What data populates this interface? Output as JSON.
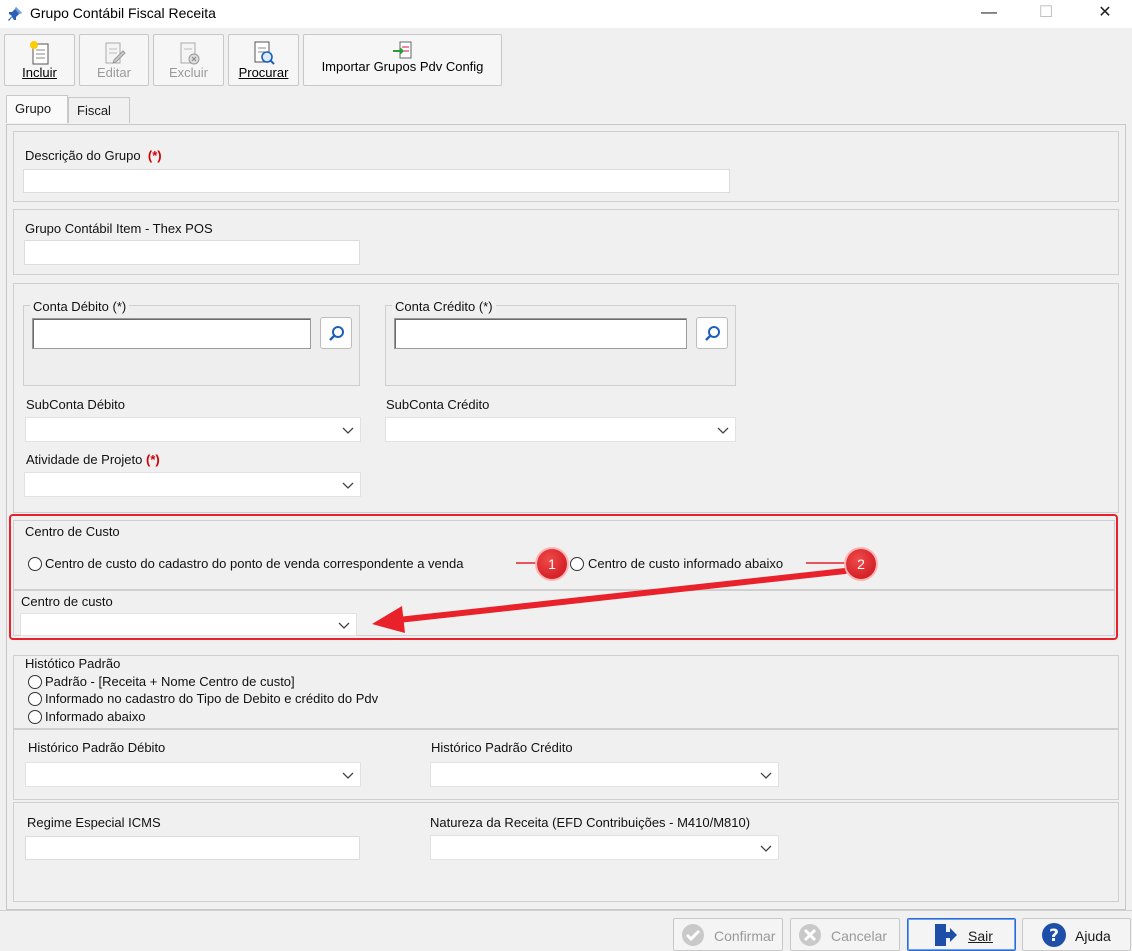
{
  "window": {
    "title": "Grupo Contábil Fiscal Receita",
    "minimize": "—",
    "maximize": "☐",
    "close": "✕"
  },
  "toolbar": {
    "incluir": "Incluir",
    "editar": "Editar",
    "excluir": "Excluir",
    "procurar": "Procurar",
    "importar": "Importar Grupos Pdv Config"
  },
  "tabs": {
    "grupo": "Grupo",
    "fiscal": "Fiscal"
  },
  "form": {
    "descricao_label": "Descrição do Grupo",
    "required_mark": "(*)",
    "descricao_value": "",
    "item_thex_label": "Grupo Contábil Item - Thex POS",
    "item_thex_value": "",
    "conta_debito_label": "Conta Débito (*)",
    "conta_debito_value": "",
    "conta_credito_label": "Conta Crédito (*)",
    "conta_credito_value": "",
    "subconta_debito_label": "SubConta Débito",
    "subconta_debito_value": "",
    "subconta_credito_label": "SubConta Crédito",
    "subconta_credito_value": "",
    "atividade_label": "Atividade de Projeto",
    "atividade_value": "",
    "centro_custo_group_label": "Centro de Custo",
    "centro_custo_option1": "Centro de custo do cadastro do ponto de venda correspondente a venda",
    "centro_custo_option2": "Centro de custo informado abaixo",
    "centro_custo_field_label": "Centro de custo",
    "centro_custo_value": "",
    "historico_label": "Histótico Padrão",
    "historico_option1": "Padrão - [Receita + Nome Centro de custo]",
    "historico_option2": "Informado no cadastro do Tipo de Debito e crédito do Pdv",
    "historico_option3": "Informado abaixo",
    "historico_debito_label": "Histórico Padrão Débito",
    "historico_debito_value": "",
    "historico_credito_label": "Histórico Padrão Crédito",
    "historico_credito_value": "",
    "regime_label": "Regime Especial ICMS",
    "regime_value": "",
    "natureza_label": "Natureza da Receita (EFD Contribuições - M410/M810)",
    "natureza_value": ""
  },
  "annotations": {
    "badge1": "1",
    "badge2": "2",
    "color": "#e8212a"
  },
  "footer": {
    "confirmar": "Confirmar",
    "cancelar": "Cancelar",
    "sair": "Sair",
    "ajuda": "Ajuda"
  }
}
